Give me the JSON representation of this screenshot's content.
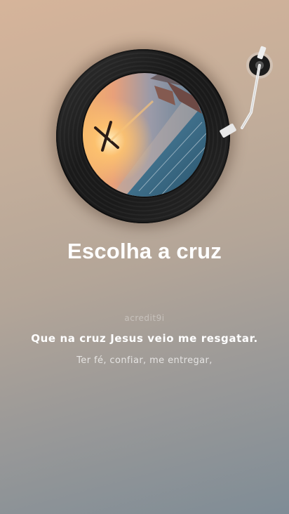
{
  "song": {
    "title": "Escolha a cruz",
    "artwork": "sunset-cross-beach-photo"
  },
  "lyrics": {
    "credit": "acredit9i",
    "current_line": "Que na cruz Jesus veio me resgatar.",
    "next_line": "Ter fé, confiar, me entregar,"
  },
  "colors": {
    "background_top": "#d6b49a",
    "background_bottom": "#7f8c96",
    "text": "#ffffff",
    "vinyl": "#1a1a1a"
  }
}
